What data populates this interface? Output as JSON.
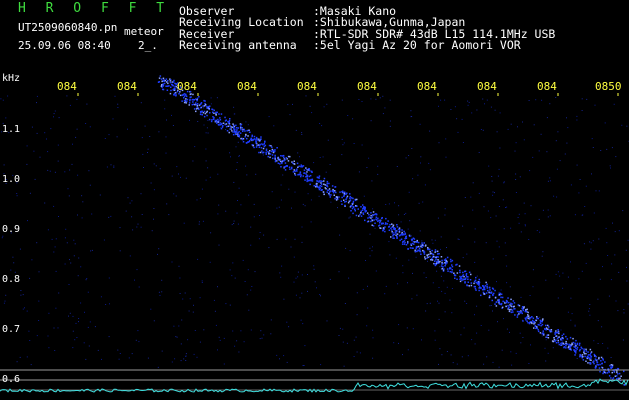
{
  "header": {
    "app_title": "H R O F F T",
    "filename": "UT2509060840.pn",
    "label_meteor": "meteor",
    "datetime": "25.09.06 08:40",
    "counter": "2_.",
    "info_labels": [
      "Observer",
      "Receiving Location",
      "Receiver",
      "Receiving antenna"
    ],
    "info_values": [
      ":Masaki Kano",
      ":Shibukawa,Gunma,Japan",
      ":RTL-SDR SDR# 43dB L15 114.1MHz USB",
      ":5el Yagi Az 20 for Aomori VOR"
    ]
  },
  "spectrogram": {
    "freq_unit": "kHz",
    "time_ticks": [
      "084",
      "084",
      "084",
      "084",
      "084",
      "084",
      "084",
      "084",
      "084",
      "0850"
    ],
    "freq_ticks": [
      "1.1",
      "1.0",
      "0.9",
      "0.8",
      "0.7",
      "0.6"
    ],
    "colors": {
      "background": "#000000",
      "signal": "#1e3cff",
      "signal_bright": "#8aa0ff",
      "level_trace": "#40e0e0",
      "axis_text": "#ffff40"
    }
  }
}
